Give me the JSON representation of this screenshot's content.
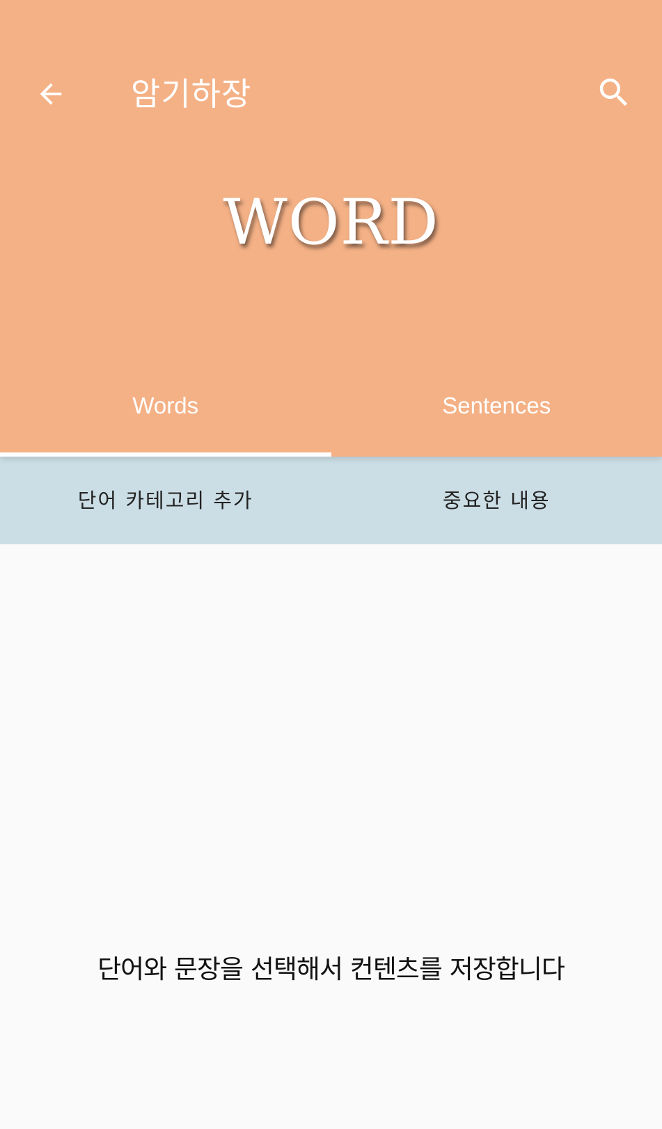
{
  "colors": {
    "header_bg": "#f4b186",
    "subbar_bg": "#ccdee5",
    "content_bg": "#fafafa",
    "header_text": "#ffffff"
  },
  "toolbar": {
    "back_icon": "arrow-back-icon",
    "title": "암기하장",
    "search_icon": "search-icon"
  },
  "hero": {
    "text": "WORD"
  },
  "tabs": [
    {
      "label": "Words",
      "selected": true
    },
    {
      "label": "Sentences",
      "selected": false
    }
  ],
  "subbar": {
    "left_label": "단어 카테고리 추가",
    "right_label": "중요한 내용"
  },
  "content": {
    "empty_message": "단어와 문장을 선택해서 컨텐츠를 저장합니다"
  }
}
